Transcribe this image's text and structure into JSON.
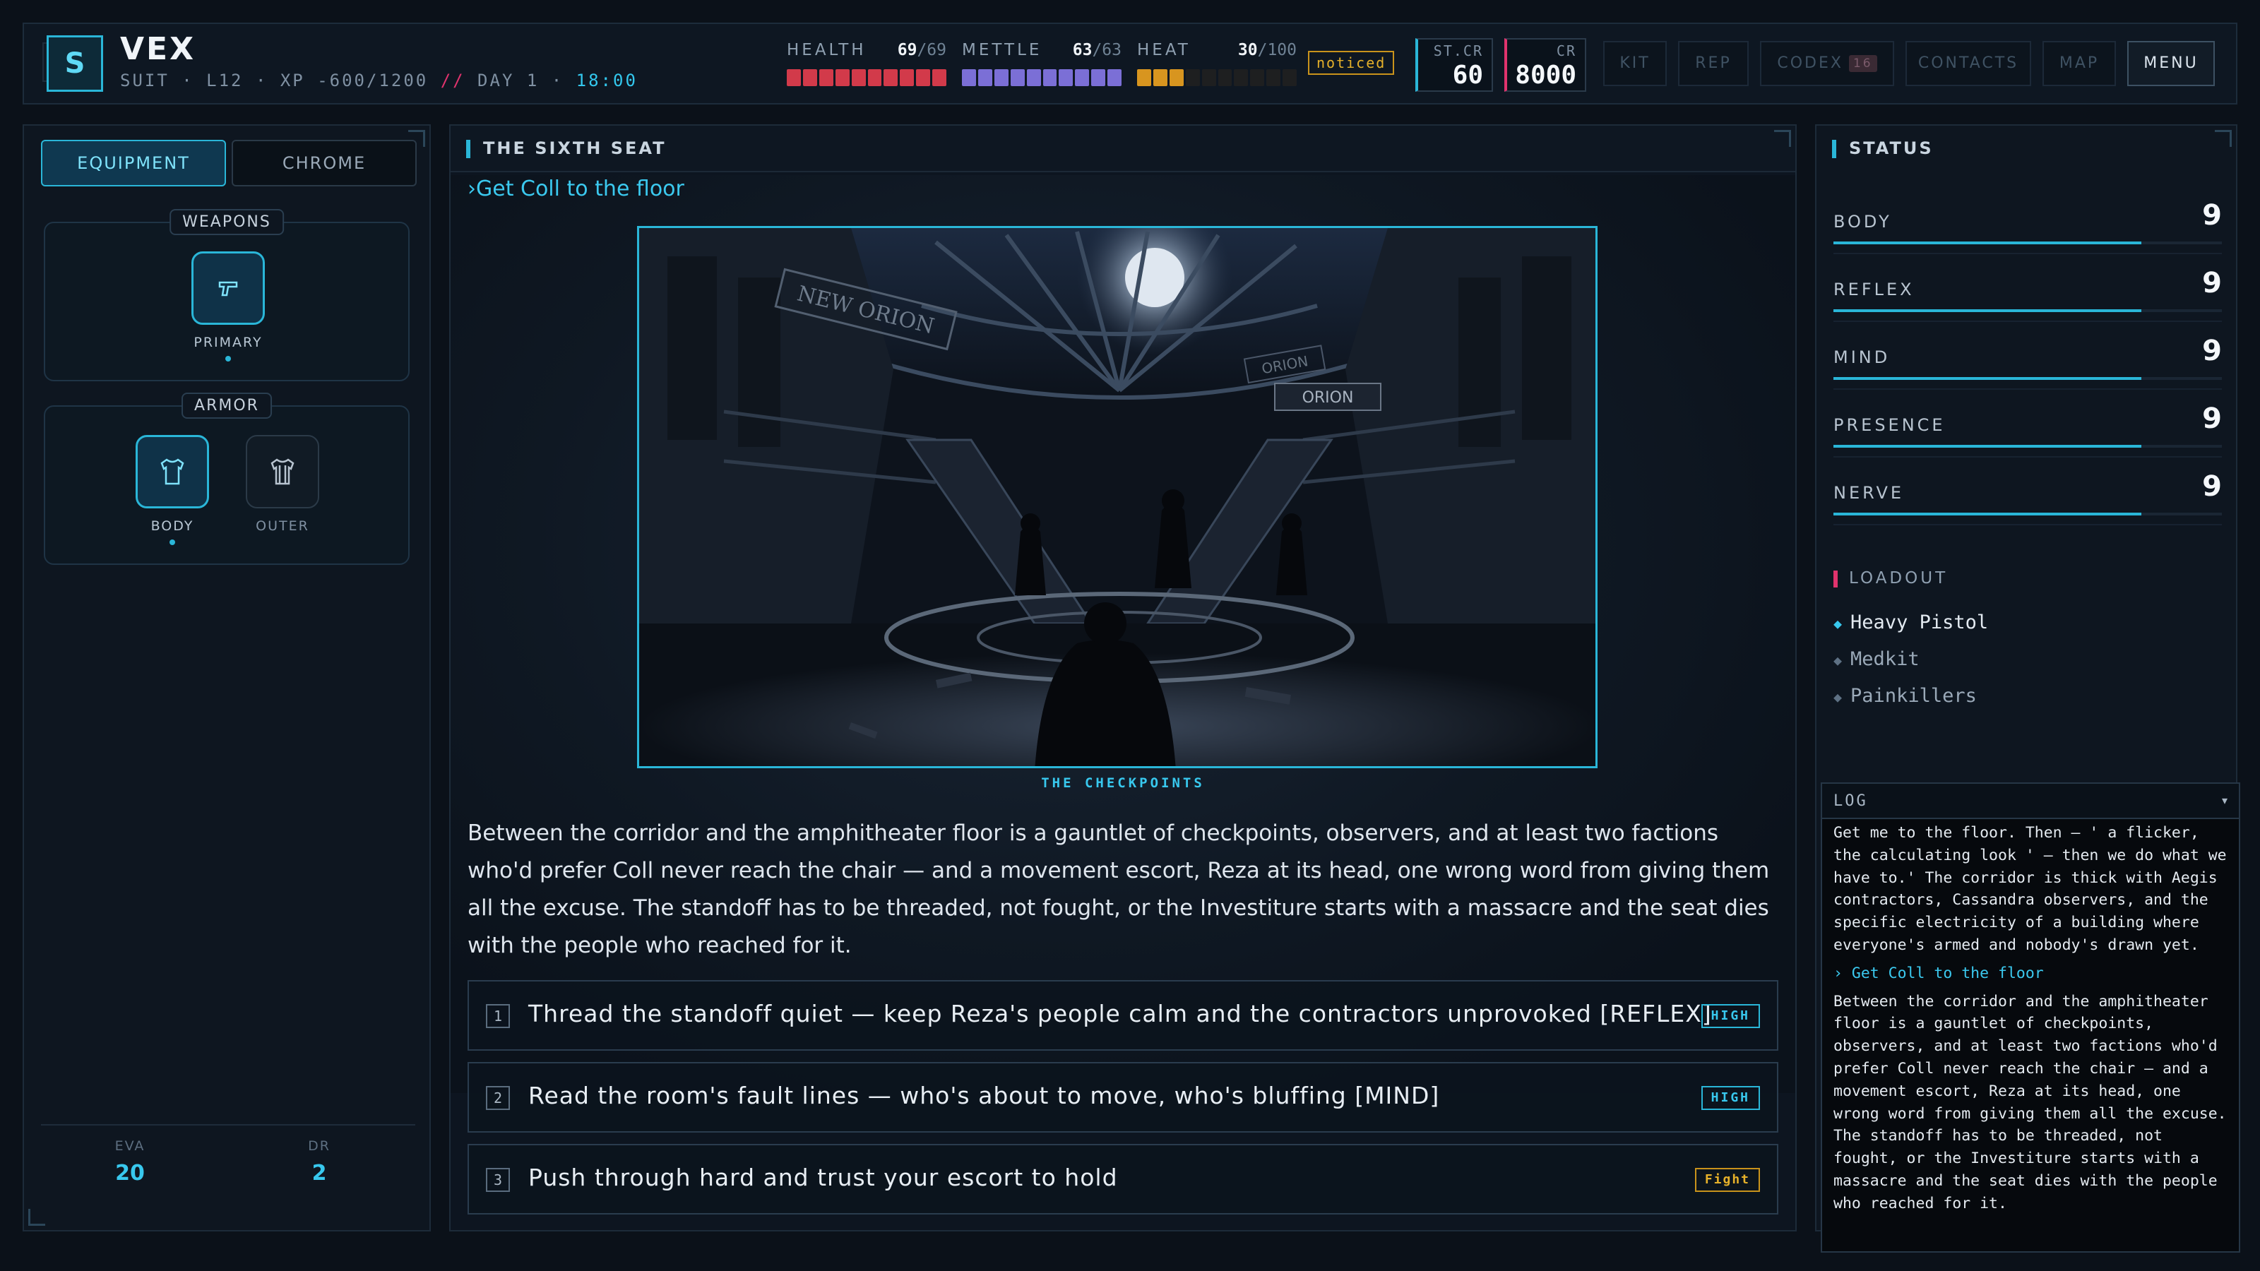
{
  "header": {
    "avatar_letter": "S",
    "name": "VEX",
    "sub_left": "SUIT · L12 · XP -600/1200",
    "sub_slash": "//",
    "sub_day": "DAY 1 ·",
    "sub_time": "18:00"
  },
  "vitals": {
    "health": {
      "label": "HEALTH",
      "value": "69",
      "max": "/69",
      "fraction": 1.0,
      "color": "#d23a4a"
    },
    "mettle": {
      "label": "METTLE",
      "value": "63",
      "max": "/63",
      "fraction": 1.0,
      "color": "#7b6fd6"
    },
    "heat": {
      "label": "HEAT",
      "value": "30",
      "max": "/100",
      "fraction": 0.3,
      "color": "#d8951f"
    },
    "status_tag": "noticed"
  },
  "currency": {
    "stcr": {
      "label": "ST.CR",
      "value": "60"
    },
    "cr": {
      "label": "CR",
      "value": "8000"
    }
  },
  "nav": {
    "kit": "KIT",
    "rep": "REP",
    "codex": "CODEX",
    "codex_badge": "16",
    "contacts": "CONTACTS",
    "map": "MAP",
    "menu": "MENU"
  },
  "left": {
    "tabs": {
      "equipment": "EQUIPMENT",
      "chrome": "CHROME"
    },
    "weapons_label": "WEAPONS",
    "primary_label": "PRIMARY",
    "armor_label": "ARMOR",
    "body_label": "BODY",
    "outer_label": "OUTER",
    "eva_label": "EVA",
    "eva_value": "20",
    "dr_label": "DR",
    "dr_value": "2"
  },
  "scene": {
    "title": "THE SIXTH SEAT",
    "objective": "›Get Coll to the floor",
    "caption": "THE CHECKPOINTS",
    "sign_left": "NEW ORION",
    "sign_right": "ORION",
    "sign_right2": "ORION",
    "narrative": "Between the corridor and the amphitheater floor is a gauntlet of checkpoints, observers, and at least two factions who'd prefer Coll never reach the chair — and a movement escort, Reza at its head, one wrong word from giving them all the excuse. The standoff has to be threaded, not fought, or the Investiture starts with a massacre and the seat dies with the people who reached for it."
  },
  "choices": [
    {
      "num": "1",
      "text": "Thread the standoff quiet — keep Reza's people calm and the contractors unprovoked [REFLEX]",
      "tag": "HIGH"
    },
    {
      "num": "2",
      "text": "Read the room's fault lines — who's about to move, who's bluffing [MIND]",
      "tag": "HIGH"
    },
    {
      "num": "3",
      "text": "Push through hard and trust your escort to hold",
      "tag": "Fight"
    }
  ],
  "status": {
    "title": "STATUS",
    "attributes": [
      {
        "label": "BODY",
        "value": "9",
        "fraction": 0.9
      },
      {
        "label": "REFLEX",
        "value": "9",
        "fraction": 0.9
      },
      {
        "label": "MIND",
        "value": "9",
        "fraction": 0.9
      },
      {
        "label": "PRESENCE",
        "value": "9",
        "fraction": 0.9
      },
      {
        "label": "NERVE",
        "value": "9",
        "fraction": 0.9
      }
    ],
    "loadout_title": "LOADOUT",
    "loadout": [
      "Heavy Pistol",
      "Medkit",
      "Painkillers"
    ]
  },
  "log": {
    "title": "LOG",
    "arrow": "▾",
    "entry_a": "Get me to the floor. Then — ' a flicker, the calculating look ' — then we do what we have to.' The corridor is thick with Aegis contractors, Cassandra observers, and the specific electricity of a building where everyone's armed and nobody's drawn yet.",
    "objective": "› Get Coll to the floor",
    "entry_b": "Between the corridor and the amphitheater floor is a gauntlet of checkpoints, observers, and at least two factions who'd prefer Coll never reach the chair — and a movement escort, Reza at its head, one wrong word from giving them all the excuse. The standoff has to be threaded, not fought, or the Investiture starts with a massacre and the seat dies with the people who reached for it."
  }
}
